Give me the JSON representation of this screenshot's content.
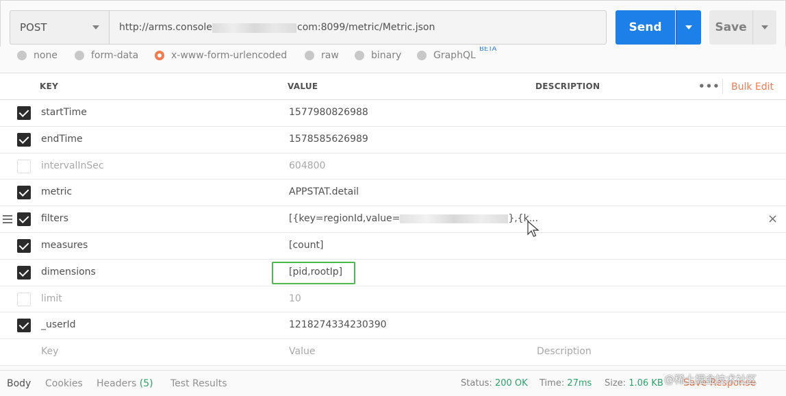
{
  "request": {
    "method": "POST",
    "url_prefix": "http://arms.console",
    "url_suffix": "com:8099/metric/Metric.json",
    "send_label": "Send",
    "save_label": "Save"
  },
  "body_types": [
    {
      "label": "none",
      "selected": false
    },
    {
      "label": "form-data",
      "selected": false
    },
    {
      "label": "x-www-form-urlencoded",
      "selected": true
    },
    {
      "label": "raw",
      "selected": false
    },
    {
      "label": "binary",
      "selected": false
    },
    {
      "label": "GraphQL",
      "selected": false
    }
  ],
  "graphql_badge": "BETA",
  "table": {
    "headers": {
      "key": "KEY",
      "value": "VALUE",
      "description": "DESCRIPTION"
    },
    "more": "•••",
    "bulk_edit": "Bulk Edit",
    "rows": [
      {
        "key": "startTime",
        "value": "1577980826988",
        "checked": true
      },
      {
        "key": "endTime",
        "value": "1578585626989",
        "checked": true
      },
      {
        "key": "intervalInSec",
        "value": "604800",
        "checked": false
      },
      {
        "key": "metric",
        "value": "APPSTAT.detail",
        "checked": true
      },
      {
        "key": "filters",
        "value_prefix": "[{key=regionId,value=",
        "value_suffix": "},{k...",
        "checked": true
      },
      {
        "key": "measures",
        "value": "[count]",
        "checked": true
      },
      {
        "key": "dimensions",
        "value": "[pid,rootIp]",
        "checked": true
      },
      {
        "key": "limit",
        "value": "10",
        "checked": false
      },
      {
        "key": "_userId",
        "value": "1218274334230390",
        "checked": true
      }
    ],
    "placeholder": {
      "key": "Key",
      "value": "Value",
      "description": "Description"
    },
    "remove_icon": "×"
  },
  "footer": {
    "tabs": [
      {
        "label": "Body"
      },
      {
        "label": "Cookies"
      },
      {
        "label": "Headers",
        "count": "(5)"
      },
      {
        "label": "Test Results"
      }
    ],
    "status_label": "Status:",
    "status_value": "200 OK",
    "time_label": "Time:",
    "time_value": "27ms",
    "size_label": "Size:",
    "size_value": "1.06 KB",
    "save_response": "Save Response",
    "watermark": "@稀土掘金技术社区"
  },
  "colors": {
    "accent": "#f27b4f",
    "send": "#1c80e8",
    "ok": "#2aa36a",
    "highlight": "#4cbb4c"
  }
}
